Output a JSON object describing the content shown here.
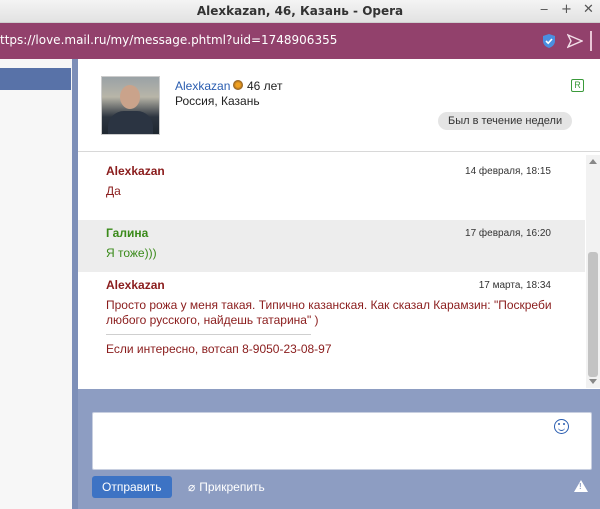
{
  "window": {
    "title": "Alexkazan, 46, Казань - Opera",
    "controls": [
      "‒",
      "+",
      "✕"
    ]
  },
  "address_bar": {
    "url": "ttps://love.mail.ru/my/message.phtml?uid=1748906355"
  },
  "profile": {
    "name": "Alexkazan",
    "age": "46 лет",
    "location": "Россия, Казань",
    "badge": "R",
    "status": "Был в течение недели"
  },
  "messages": [
    {
      "author": "Alexkazan",
      "time": "14 февраля, 18:15",
      "text": "Да"
    },
    {
      "author": "Галина",
      "time": "17 февраля, 16:20",
      "text": "Я тоже)))"
    },
    {
      "author": "Alexkazan",
      "time": "17 марта, 18:34",
      "text": "Просто рожа у меня такая. Типично казанская. Как сказал Карамзин: \"Поскреби любого русского, найдешь татарина\" )",
      "extra": "Если интересно, вотсап 8-9050-23-08-97"
    }
  ],
  "compose": {
    "value": "",
    "send_label": "Отправить",
    "attach_label": "Прикрепить"
  },
  "colors": {
    "addr_bar": "#92416c",
    "compose_bg": "#8d9dc2",
    "send_button": "#3d73c4",
    "author_red": "#8a1c1c",
    "author_green": "#3a8a1a"
  }
}
